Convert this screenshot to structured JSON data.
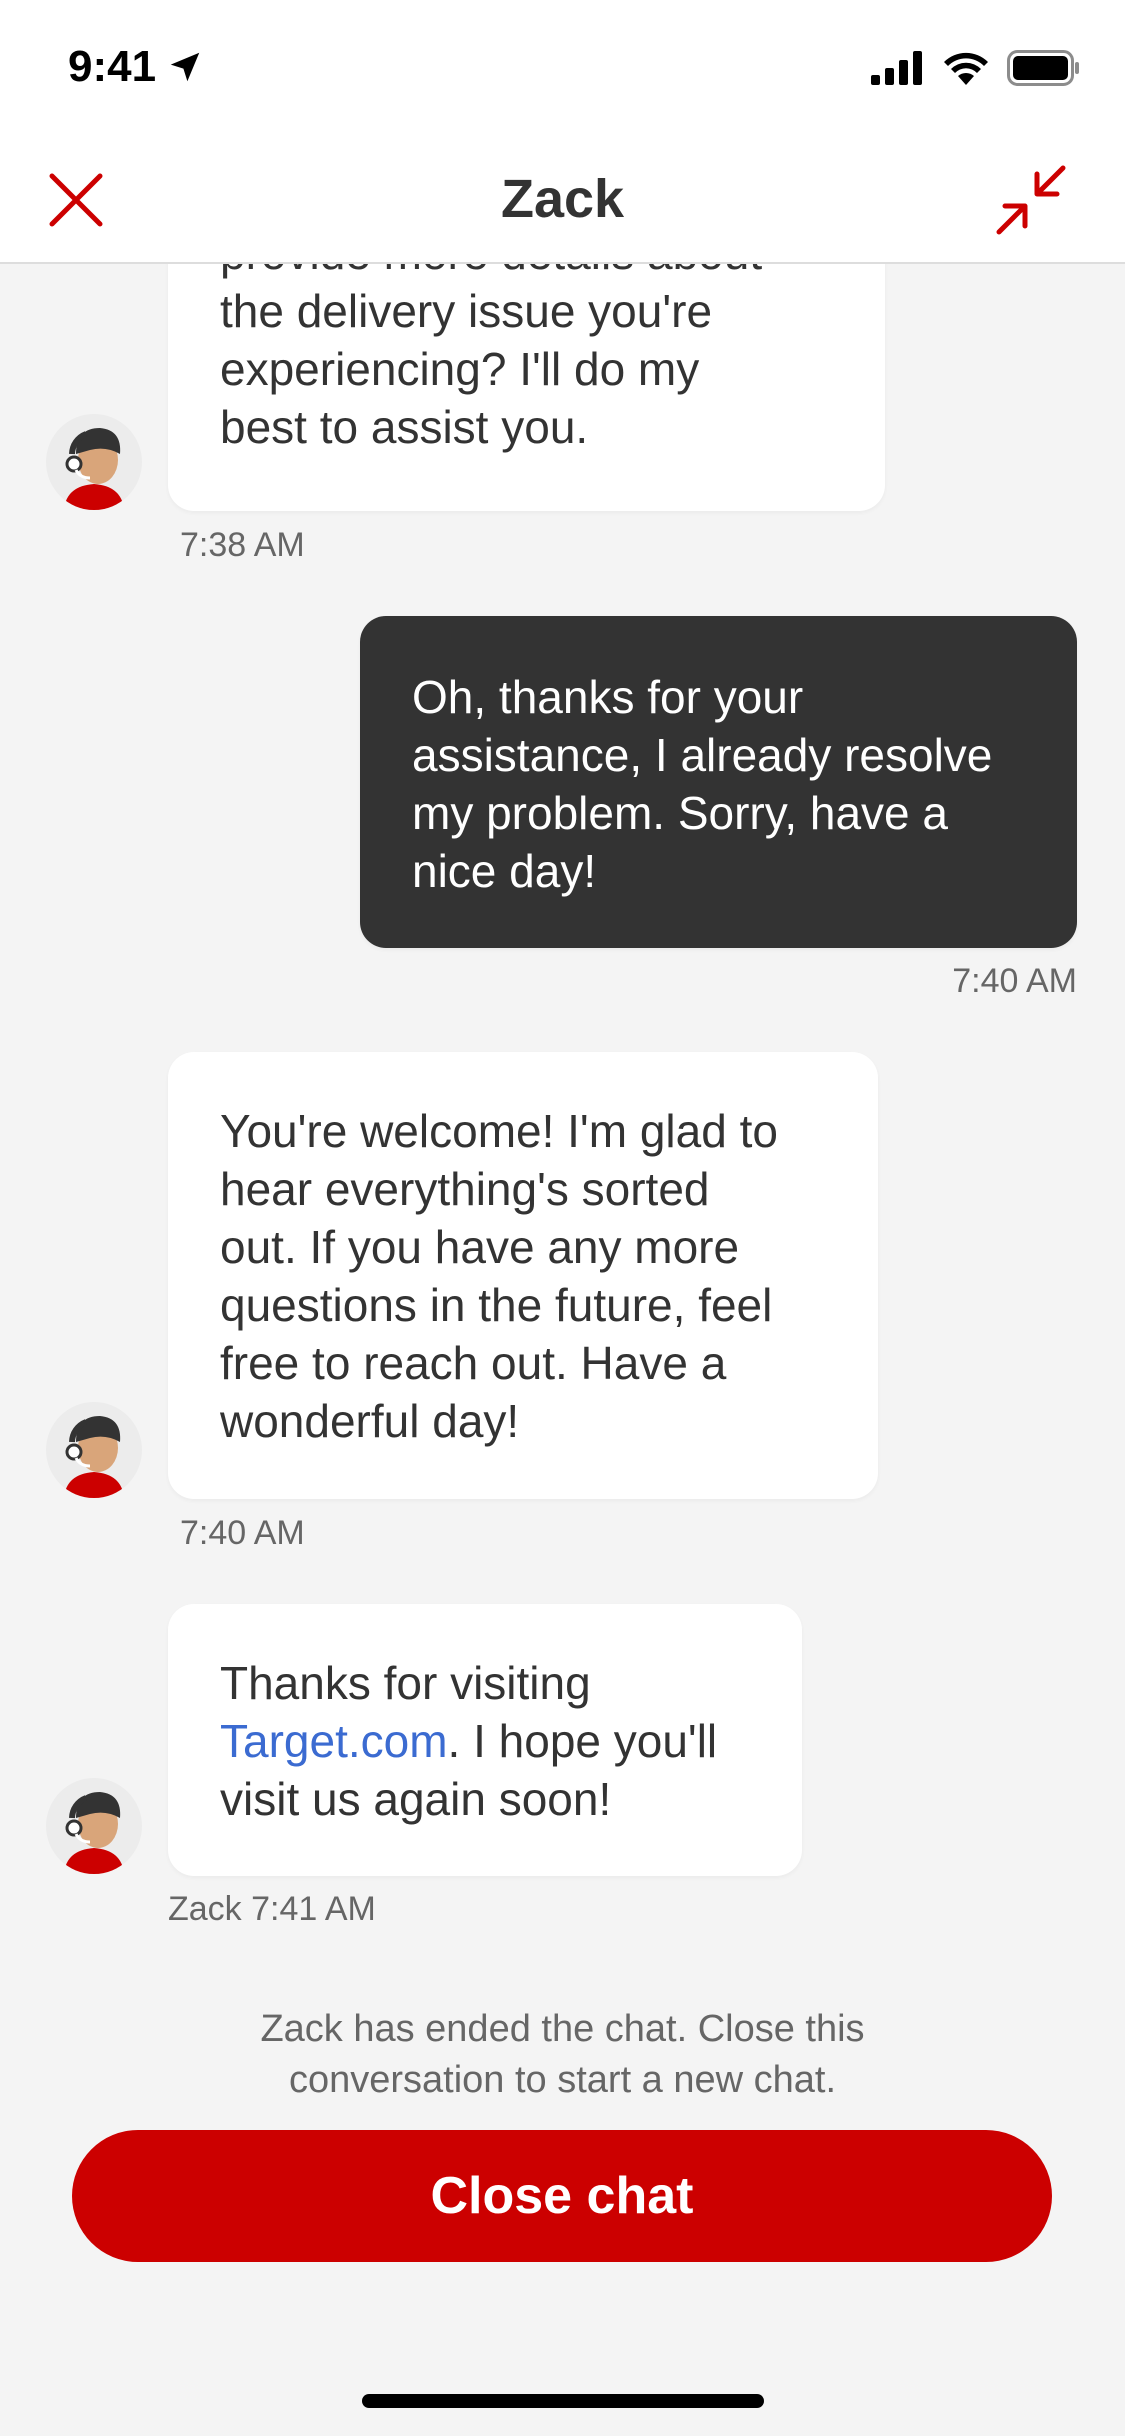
{
  "status_bar": {
    "time": "9:41"
  },
  "header": {
    "title": "Zack"
  },
  "messages": [
    {
      "lines": [
        "provide more details about",
        "the delivery issue you're",
        "experiencing? I'll do my",
        "best to assist you."
      ],
      "time": "7:38 AM"
    },
    {
      "lines": [
        "Oh, thanks for your",
        "assistance, I already resolve",
        "my problem. Sorry, have a",
        "nice day!"
      ],
      "time": "7:40 AM"
    },
    {
      "lines": [
        "You're welcome! I'm glad to",
        "hear everything's sorted",
        "out. If you have any more",
        "questions in the future, feel",
        "free to reach out. Have a",
        "wonderful day!"
      ],
      "time": "7:40 AM"
    },
    {
      "line1": "Thanks for visiting",
      "link": "Target.com",
      "line2_rest": ". I hope you'll",
      "line3": "visit us again soon!",
      "time": "Zack 7:41 AM"
    }
  ],
  "ended_notice": [
    "Zack has ended the chat. Close this",
    "conversation to start a new chat."
  ],
  "close_button_label": "Close chat",
  "colors": {
    "accent": "#cc0000",
    "user_bubble": "#333333",
    "link": "#3b6bd1"
  }
}
